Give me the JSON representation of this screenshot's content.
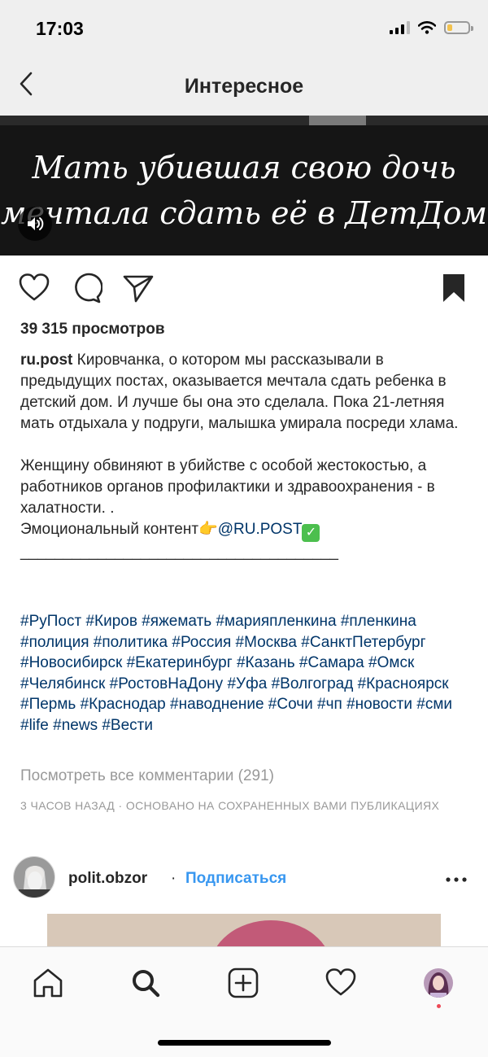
{
  "status_bar": {
    "time": "17:03",
    "battery_color": "#f3c24d"
  },
  "header": {
    "title": "Интересное",
    "back_icon": "chevron-left-icon"
  },
  "video": {
    "caption": "Мать убившая свою дочь\nмечтала сдать её в ДетДом",
    "sound_icon": "speaker-icon"
  },
  "actions": {
    "like_icon": "heart-icon",
    "comment_icon": "comment-icon",
    "share_icon": "send-icon",
    "save_icon": "bookmark-icon"
  },
  "post": {
    "views": "39 315 просмотров",
    "username": "ru.post",
    "caption_text": " Кировчанка, о котором мы рассказывали в предыдущих постах, оказывается мечтала сдать ребенка в детский дом. И лучше бы она это сделала. Пока 21-летняя мать отдыхала у подруги, малышка умирала посреди хлама.\n\nЖенщину обвиняют в убийстве с особой жестокостью, а работников органов профилактики и здравоохранения - в халатности. .\nЭмоциональный контент👉",
    "mention": "@RU.POST",
    "check_emoji": "✓",
    "separator": "_____________________________________",
    "hashtags": [
      "#РуПост",
      "#Киров",
      "#яжемать",
      "#марияпленкина",
      "#пленкина",
      "#полиция",
      "#политика",
      "#Россия",
      "#Москва",
      "#СанктПетербург",
      "#Новосибирск",
      "#Екатеринбург",
      "#Казань",
      "#Самара",
      "#Омск",
      "#Челябинск",
      "#РостовНаДону",
      "#Уфа",
      "#Волгоград",
      "#Красноярск",
      "#Пермь",
      "#Краснодар",
      "#наводнение",
      "#Сочи",
      "#чп",
      "#новости",
      "#сми",
      "#life",
      "#news",
      "#Вести"
    ],
    "comments_link": "Посмотреть все комментарии (291)",
    "timestamp": "3 ЧАСОВ НАЗАД · ОСНОВАНО НА СОХРАНЕННЫХ ВАМИ ПУБЛИКАЦИЯХ"
  },
  "next_post": {
    "username": "polit.obzor",
    "dot": "·",
    "follow_label": "Подписаться",
    "more_icon": "more-horizontal-icon"
  },
  "tab_bar": {
    "items": [
      "home-icon",
      "search-icon",
      "add-post-icon",
      "activity-heart-icon",
      "profile-avatar"
    ]
  },
  "colors": {
    "link": "#003569",
    "follow": "#3897f0",
    "muted": "#999999"
  }
}
